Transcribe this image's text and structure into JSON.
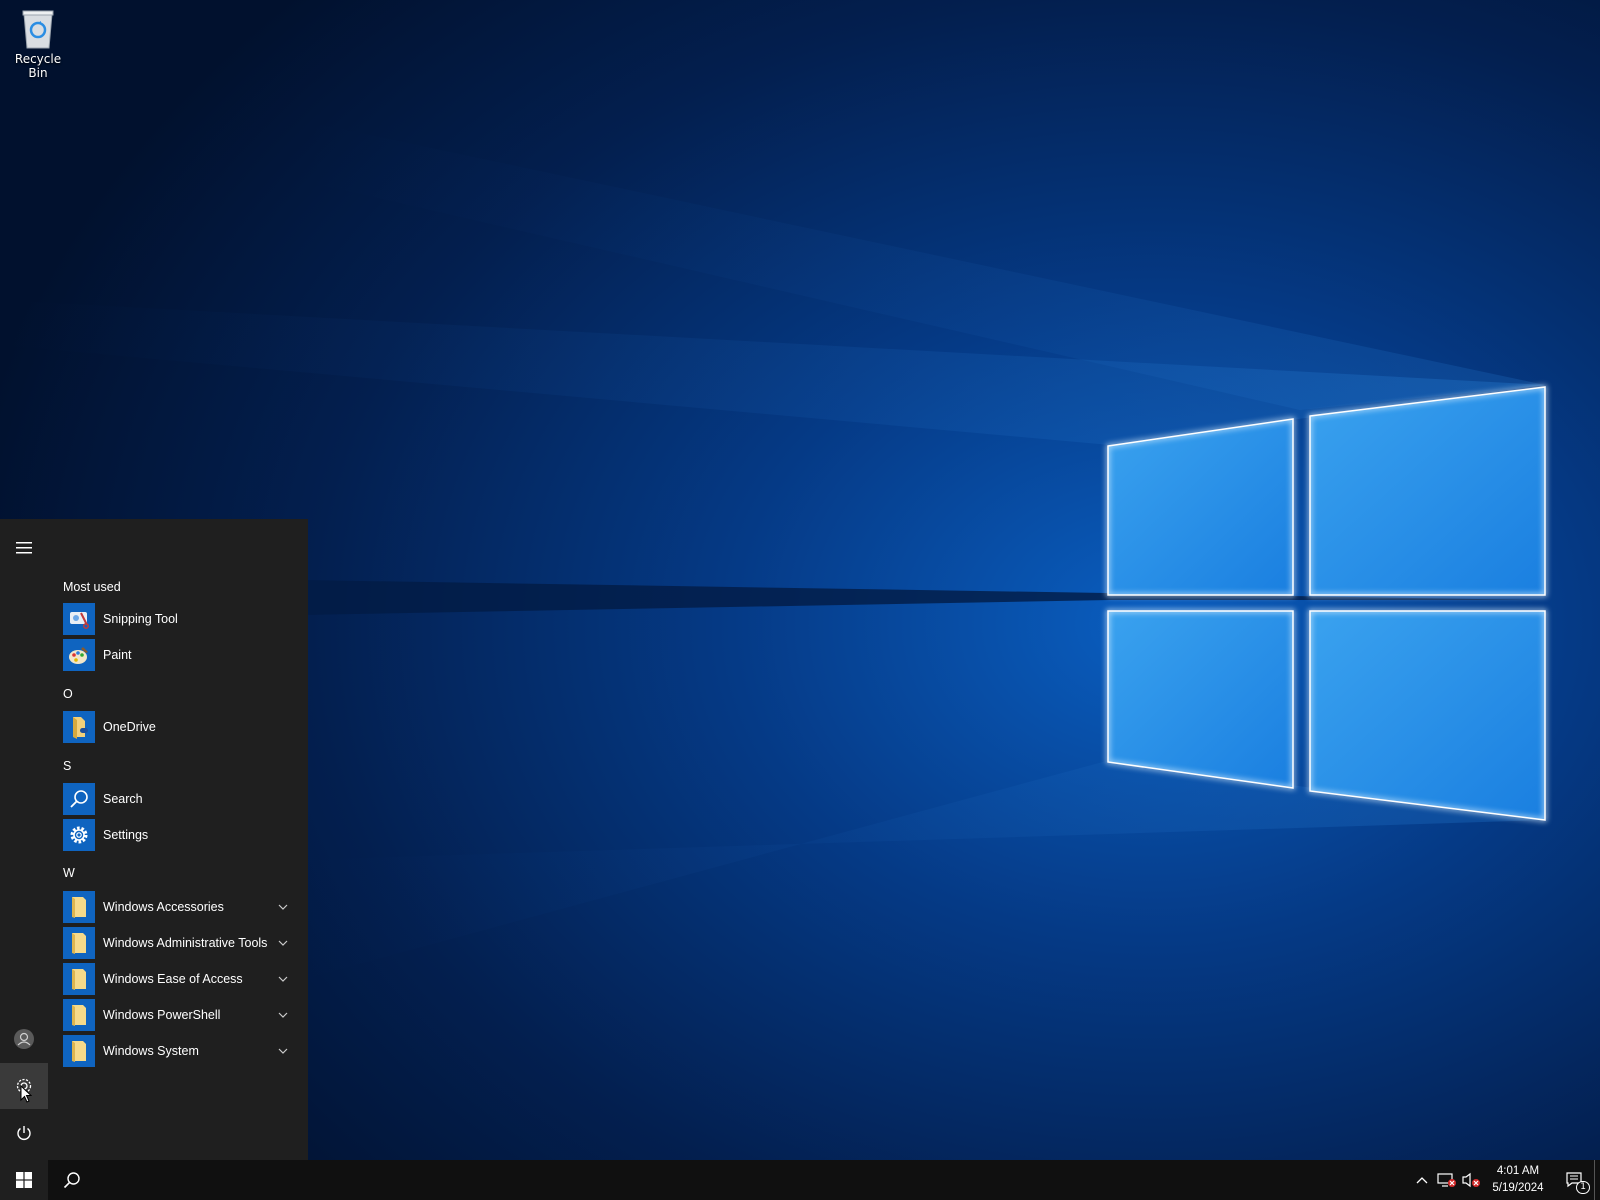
{
  "desktop": {
    "icons": [
      {
        "label": "Recycle Bin",
        "icon": "recycle-bin-icon"
      }
    ]
  },
  "start_menu": {
    "rail": {
      "menu_icon": "hamburger-menu-icon",
      "user_icon": "user-account-icon",
      "settings_icon": "settings-gear-icon",
      "power_icon": "power-icon"
    },
    "sections": [
      {
        "header": "Most used",
        "items": [
          {
            "label": "Snipping Tool",
            "icon": "snipping-tool-icon"
          },
          {
            "label": "Paint",
            "icon": "paint-icon"
          }
        ]
      },
      {
        "header": "O",
        "items": [
          {
            "label": "OneDrive",
            "icon": "onedrive-folder-icon"
          }
        ]
      },
      {
        "header": "S",
        "items": [
          {
            "label": "Search",
            "icon": "search-icon"
          },
          {
            "label": "Settings",
            "icon": "gear-icon"
          }
        ]
      },
      {
        "header": "W",
        "items": [
          {
            "label": "Windows Accessories",
            "icon": "folder-icon",
            "expandable": true
          },
          {
            "label": "Windows Administrative Tools",
            "icon": "folder-icon",
            "expandable": true
          },
          {
            "label": "Windows Ease of Access",
            "icon": "folder-icon",
            "expandable": true
          },
          {
            "label": "Windows PowerShell",
            "icon": "folder-icon",
            "expandable": true
          },
          {
            "label": "Windows System",
            "icon": "folder-icon",
            "expandable": true
          }
        ]
      }
    ]
  },
  "taskbar": {
    "start_icon": "windows-logo-icon",
    "search_icon": "search-icon",
    "tray_icons": [
      "chevron-up-icon",
      "network-disconnected-icon",
      "volume-muted-icon"
    ],
    "clock": {
      "time": "4:01 AM",
      "date": "5/19/2024"
    },
    "notifications": {
      "icon": "action-center-icon",
      "count": "1"
    }
  },
  "colors": {
    "accent": "#0f64c0",
    "menu_bg": "#1f1f1f",
    "taskbar_bg": "#101010"
  }
}
